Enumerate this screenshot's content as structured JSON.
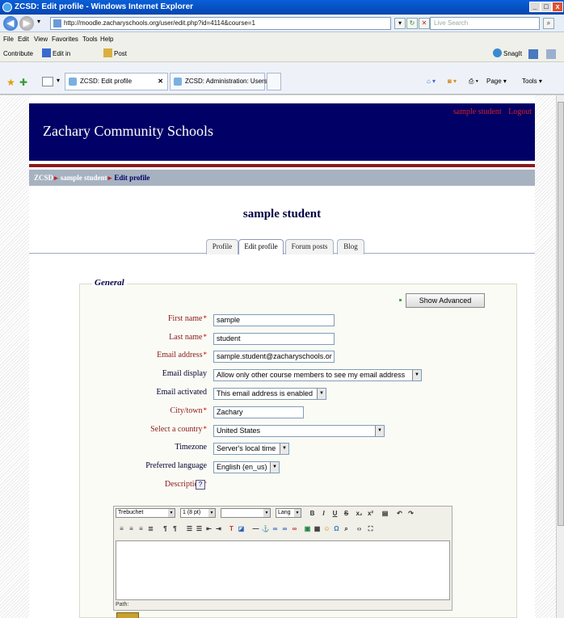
{
  "window": {
    "title": "ZCSD: Edit profile - Windows Internet Explorer",
    "controls": [
      "_",
      "□",
      "x"
    ]
  },
  "address_bar": {
    "url": "http://moodle.zacharyschools.org/user/edit.php?id=4114&course=1",
    "search_placeholder": "Live Search"
  },
  "menu": {
    "items": [
      "File",
      "Edit",
      "View",
      "Favorites",
      "Tools",
      "Help"
    ]
  },
  "toolbar": {
    "contribute": "Contribute",
    "edit_in_contribute": "Edit in Contribute",
    "post_to_blog": "Post to Blog",
    "snagit": "SnagIt"
  },
  "tabs": {
    "items": [
      "ZCSD: Edit profile",
      "ZCSD: Administration: Users..."
    ],
    "page_menu": "Page",
    "tools_menu": "Tools"
  },
  "site": {
    "name": "Zachary Community Schools",
    "login_user": "sample student",
    "logout": "Logout"
  },
  "breadcrumb": {
    "home": "ZCSD",
    "user": "sample student",
    "current": "Edit profile",
    "separator": "▸"
  },
  "profile": {
    "heading": "sample student",
    "tabs": [
      "Profile",
      "Edit profile",
      "Forum posts",
      "Blog"
    ],
    "active_tab": "Edit profile"
  },
  "form": {
    "section_title": "General",
    "show_advanced": "Show Advanced",
    "required_marker": "*",
    "first_name": {
      "label": "First name",
      "value": "sample"
    },
    "last_name": {
      "label": "Last name",
      "value": "student"
    },
    "email": {
      "label": "Email address",
      "value": "sample.student@zacharyschools.or"
    },
    "email_display": {
      "label": "Email display",
      "value": "Allow only other course members to see my email address"
    },
    "email_activated": {
      "label": "Email activated",
      "value": "This email address is enabled"
    },
    "city": {
      "label": "City/town",
      "value": "Zachary"
    },
    "country": {
      "label": "Select a country",
      "value": "United States"
    },
    "timezone": {
      "label": "Timezone",
      "value": "Server's local time"
    },
    "language": {
      "label": "Preferred language",
      "value": "English (en_us)"
    },
    "description": {
      "label": "Description",
      "help": "?"
    }
  },
  "editor": {
    "font": "Trebuchet",
    "size": "1 (8 pt)",
    "style": "",
    "lang": "Lang",
    "path_label": "Path:"
  }
}
